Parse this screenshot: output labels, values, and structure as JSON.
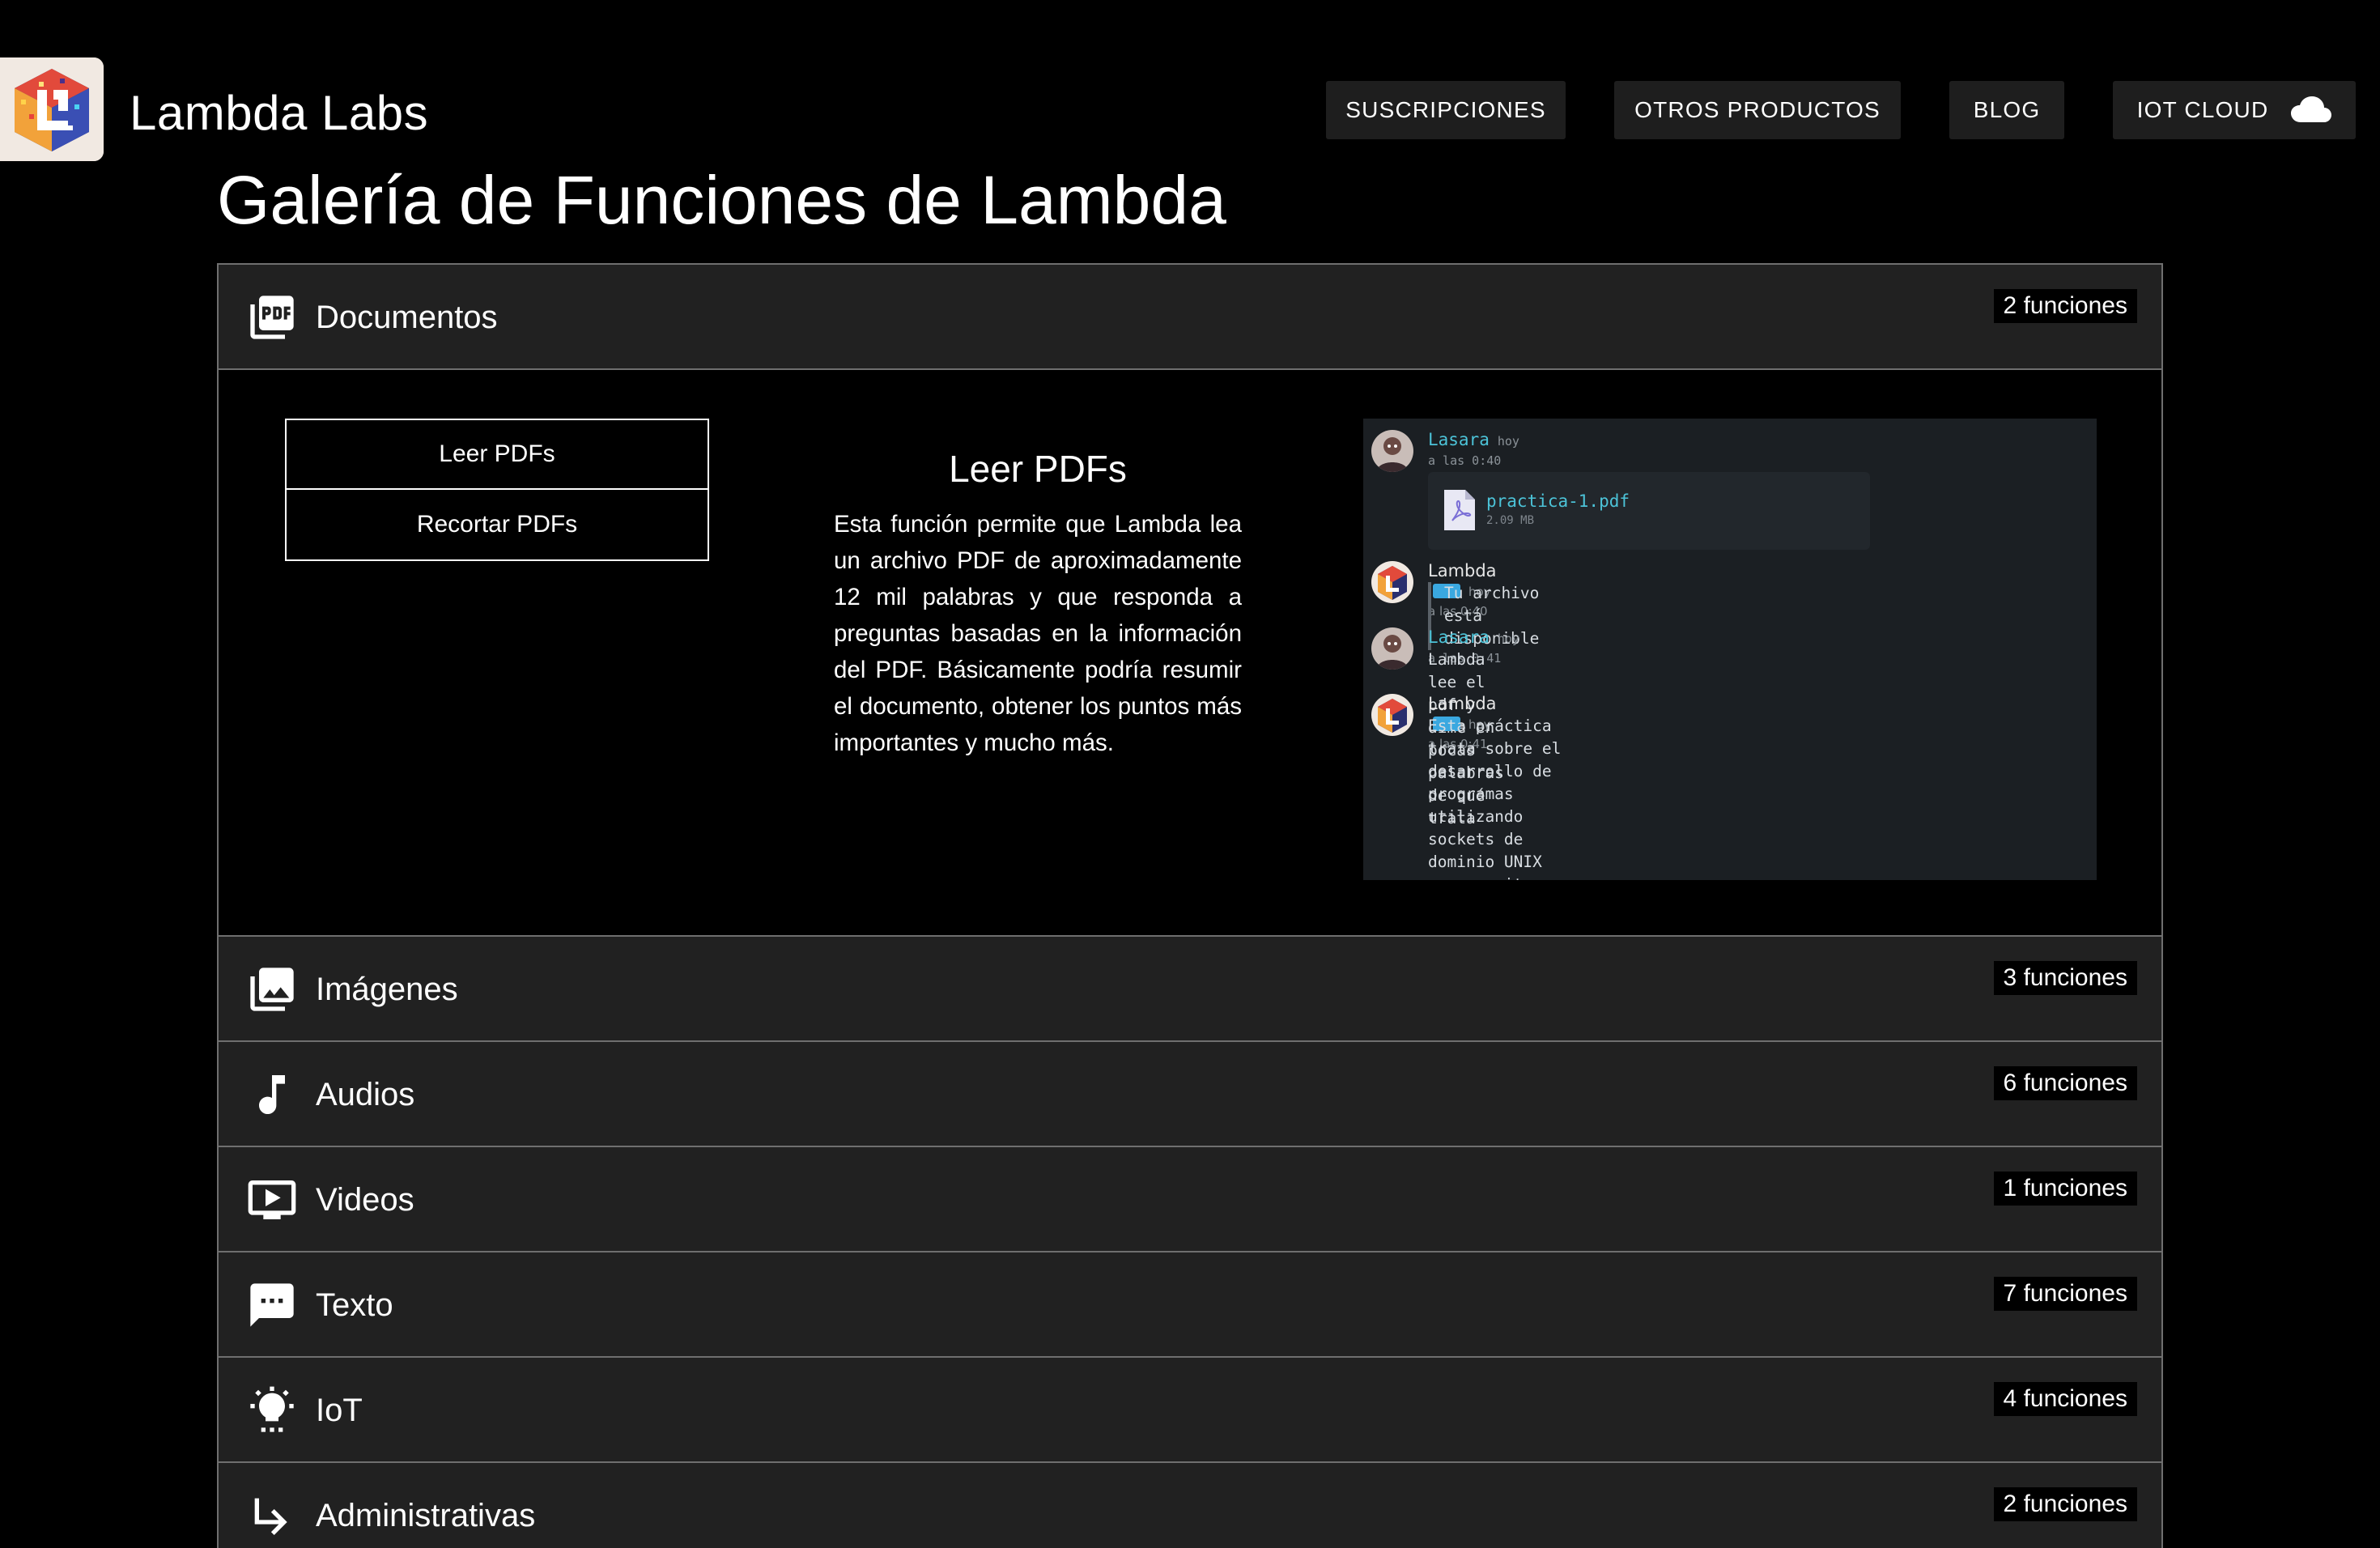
{
  "header": {
    "brand": "Lambda Labs",
    "nav": [
      {
        "label": "SUSCRIPCIONES"
      },
      {
        "label": "OTROS PRODUCTOS"
      },
      {
        "label": "BLOG"
      },
      {
        "label": "IOT CLOUD",
        "icon": "cloud-icon"
      }
    ]
  },
  "page": {
    "title": "Galería de Funciones de Lambda"
  },
  "sections": [
    {
      "label": "Documentos",
      "count": "2 funciones",
      "icon": "pdf-icon",
      "expanded": true
    },
    {
      "label": "Imágenes",
      "count": "3 funciones",
      "icon": "image-icon"
    },
    {
      "label": "Audios",
      "count": "6 funciones",
      "icon": "music-note-icon"
    },
    {
      "label": "Videos",
      "count": "1 funciones",
      "icon": "video-icon"
    },
    {
      "label": "Texto",
      "count": "7 funciones",
      "icon": "chat-bubble-icon"
    },
    {
      "label": "IoT",
      "count": "4 funciones",
      "icon": "light-bulb-icon"
    },
    {
      "label": "Administrativas",
      "count": "2 funciones",
      "icon": "subdirectory-arrow-icon"
    }
  ],
  "documentos": {
    "functions": [
      "Leer PDFs",
      "Recortar PDFs"
    ],
    "selected": {
      "title": "Leer PDFs",
      "description": "Esta función permite que Lambda lea un archivo PDF de aproximadamente 12 mil palabras y que responda a preguntas basadas en la información del PDF. Básicamente podría resumir el documento, obtener los puntos más importantes y mucho más."
    },
    "chat": {
      "messages": [
        {
          "author": "Lasara",
          "time": "hoy a las 0:40",
          "file_name": "practica-1.pdf",
          "file_size": "2.09 MB"
        },
        {
          "author": "Lambda",
          "time": "hoy a las 0:40",
          "text": "Tu archivo está disponible"
        },
        {
          "author": "Lasara",
          "time": "hoy a las 0:41",
          "text": "Lambda lee el pdf y dime en pocas palabras de qué trata"
        },
        {
          "author": "Lambda",
          "time": "hoy a las 0:41",
          "text": "Esta práctica trata sobre el desarrollo de programas utilizando\nsockets de dominio UNIX que permiten una comunicación bidireccional\nentre un cliente y un servidor. Se realiza una modificación en los\ncódigos para lograr esta comunicación y se investiga la ubicación\ndel archivo de socket utilizado por el servidor de bases de datos\nMySQL (o MariaDB). Al final, se logra entender el funcionamiento de\nlos sockets y su importancia en las comunicaciones entre procesos."
        }
      ]
    }
  }
}
